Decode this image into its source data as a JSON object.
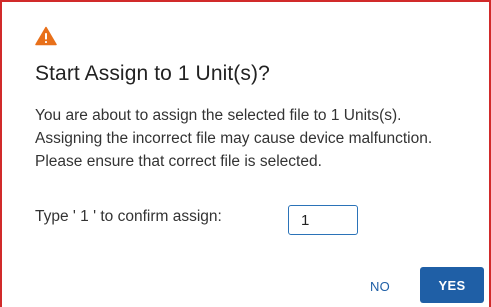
{
  "dialog": {
    "icon": "warning-triangle-icon",
    "title": "Start Assign to 1 Unit(s)?",
    "message_lines": [
      "You are about to assign the selected file to 1 Units(s).",
      "Assigning the incorrect file may cause device malfunction.",
      "Please ensure that correct file is selected."
    ],
    "confirm": {
      "label": "Type ' 1 ' to confirm assign:",
      "value": "1"
    },
    "buttons": {
      "no_label": "NO",
      "yes_label": "YES"
    }
  },
  "colors": {
    "border": "#d12a2a",
    "warning": "#e8701a",
    "primary": "#1f5fa6",
    "input_border": "#2b73b8"
  }
}
